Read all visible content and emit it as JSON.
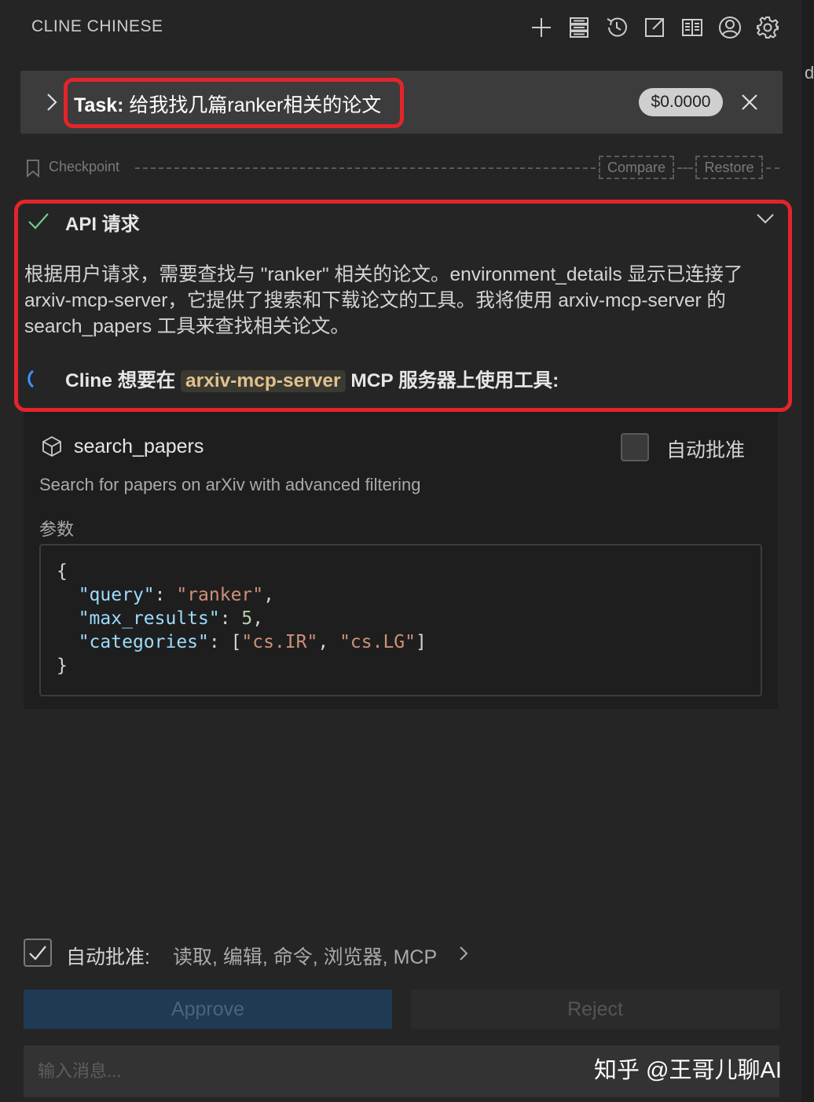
{
  "header": {
    "title": "CLINE CHINESE",
    "icons": [
      "plus-icon",
      "server-icon",
      "history-icon",
      "external-link-icon",
      "book-icon",
      "account-icon",
      "gear-icon"
    ]
  },
  "task": {
    "prefix": "Task:",
    "text": "给我找几篇ranker相关的论文",
    "cost": "$0.0000"
  },
  "checkpoint": {
    "label": "Checkpoint",
    "compare": "Compare",
    "restore": "Restore"
  },
  "api_request": {
    "title": "API 请求",
    "body": "根据用户请求，需要查找与 \"ranker\" 相关的论文。environment_details 显示已连接了 arxiv-mcp-server，它提供了搜索和下载论文的工具。我将使用 arxiv-mcp-server 的 search_papers 工具来查找相关论文。",
    "mcp_prefix": "Cline 想要在",
    "server_name": "arxiv-mcp-server",
    "mcp_suffix": "MCP 服务器上使用工具:"
  },
  "tool": {
    "name": "search_papers",
    "auto_approve_label": "自动批准",
    "description": "Search for papers on arXiv with advanced filtering",
    "params_label": "参数",
    "params": {
      "open": "{",
      "query_key": "\"query\"",
      "query_val": "\"ranker\"",
      "max_key": "\"max_results\"",
      "max_val": "5",
      "cat_key": "\"categories\"",
      "cat_1": "\"cs.IR\"",
      "cat_2": "\"cs.LG\"",
      "close": "}"
    }
  },
  "auto_approve": {
    "label": "自动批准:",
    "items": "读取, 编辑, 命令, 浏览器, MCP"
  },
  "actions": {
    "approve": "Approve",
    "reject": "Reject"
  },
  "input": {
    "placeholder": "输入消息..."
  },
  "watermark": "知乎 @王哥儿聊AI",
  "edge_text": "de",
  "colors": {
    "highlight_border": "#e3252b",
    "check_green": "#73c991",
    "spinner_blue": "#3794ff",
    "server_chip_text": "#e2c08d"
  }
}
